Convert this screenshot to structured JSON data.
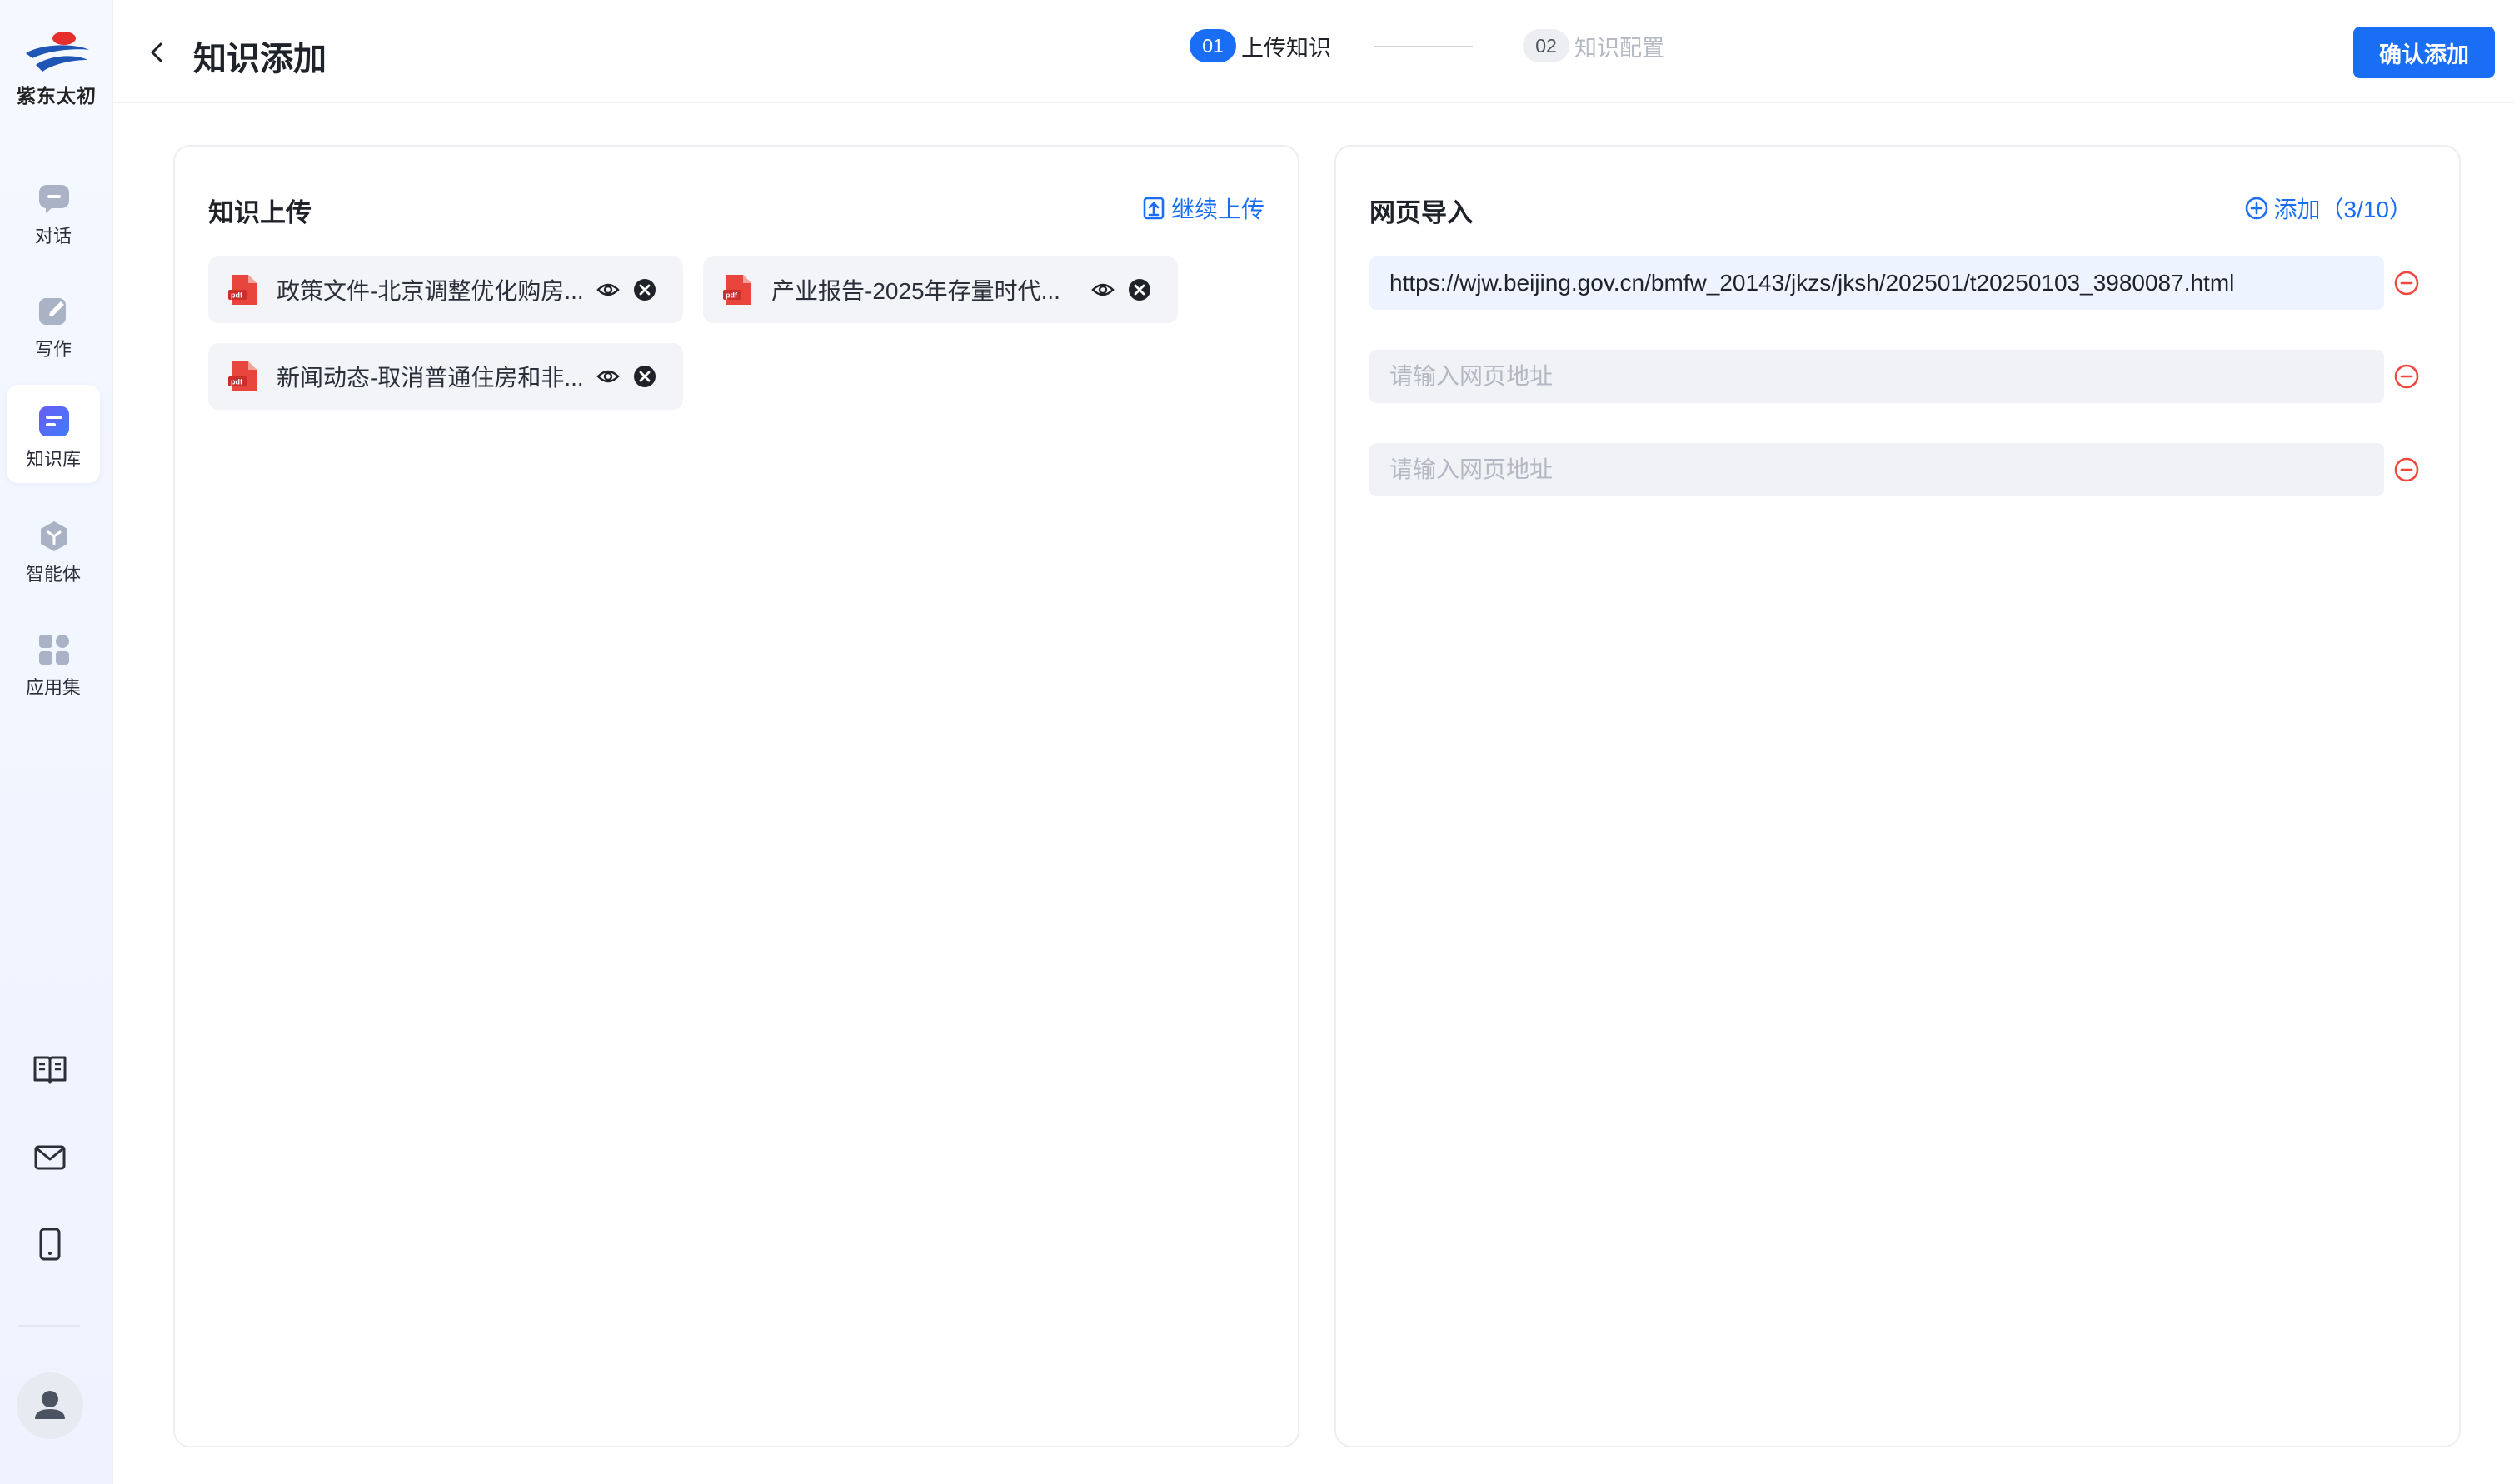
{
  "sidebar": {
    "logo_text": "紫东太初",
    "items": [
      {
        "label": "对话",
        "icon": "chat-bubble-icon"
      },
      {
        "label": "写作",
        "icon": "pen-icon"
      },
      {
        "label": "知识库",
        "icon": "knowledge-base-icon",
        "active": true
      },
      {
        "label": "智能体",
        "icon": "agent-cube-icon"
      },
      {
        "label": "应用集",
        "icon": "app-grid-icon"
      }
    ],
    "bottom_icons": [
      "book-icon",
      "mail-icon",
      "phone-icon"
    ],
    "avatar_icon": "user-avatar-icon"
  },
  "header": {
    "title": "知识添加",
    "steps": [
      {
        "num": "01",
        "label": "上传知识",
        "active": true
      },
      {
        "num": "02",
        "label": "知识配置",
        "active": false
      }
    ],
    "confirm_label": "确认添加"
  },
  "upload_panel": {
    "title": "知识上传",
    "action_label": "继续上传",
    "files": [
      {
        "name": "政策文件-北京调整优化购房...",
        "type": "pdf"
      },
      {
        "name": "产业报告-2025年存量时代...",
        "type": "pdf"
      },
      {
        "name": "新闻动态-取消普通住房和非...",
        "type": "pdf"
      }
    ]
  },
  "web_panel": {
    "title": "网页导入",
    "action_label": "添加（3/10）",
    "urls": [
      {
        "value": "https://wjw.beijing.gov.cn/bmfw_20143/jkzs/jksh/202501/t20250103_3980087.html",
        "placeholder": "请输入网页地址"
      },
      {
        "value": "",
        "placeholder": "请输入网页地址"
      },
      {
        "value": "",
        "placeholder": "请输入网页地址"
      }
    ]
  },
  "colors": {
    "accent": "#1a6ef5",
    "remove": "#f0483e",
    "pdf": "#e8453c"
  }
}
